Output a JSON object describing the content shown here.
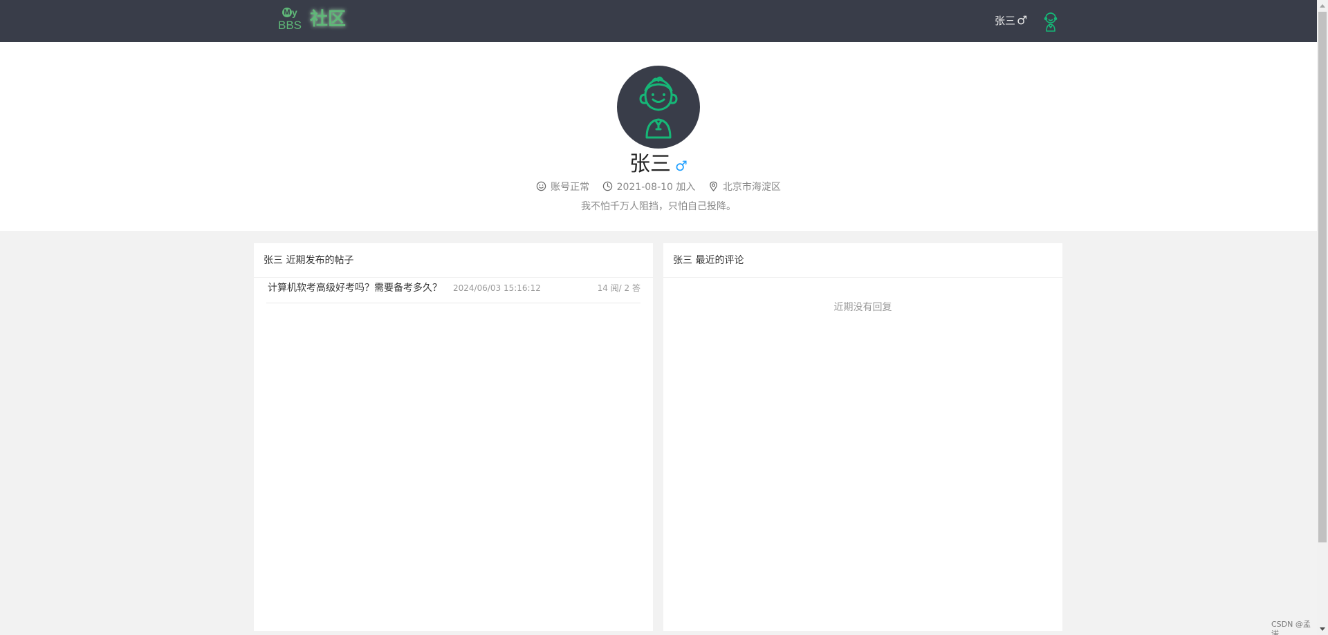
{
  "header": {
    "logo": {
      "my": "My",
      "bbs": "BBS",
      "community": "社区"
    },
    "username": "张三",
    "gender_symbol": "♂"
  },
  "profile": {
    "name": "张三",
    "gender_symbol": "♂",
    "status": "账号正常",
    "joined": "2021-08-10 加入",
    "location": "北京市海淀区",
    "signature": "我不怕千万人阻挡，只怕自己投降。"
  },
  "posts_panel": {
    "title": "张三 近期发布的帖子",
    "posts": [
      {
        "title": "计算机软考高级好考吗？需要备考多久？",
        "time": "2024/06/03 15:16:12",
        "stats": "14 阅/ 2 答"
      }
    ]
  },
  "comments_panel": {
    "title": "张三 最近的评论",
    "empty_text": "近期没有回复"
  },
  "watermark": "CSDN @孟诺",
  "colors": {
    "header_bg": "#393d49",
    "accent_green": "#5fb878",
    "avatar_green": "#16b777",
    "gender_blue": "#1e9fff"
  }
}
